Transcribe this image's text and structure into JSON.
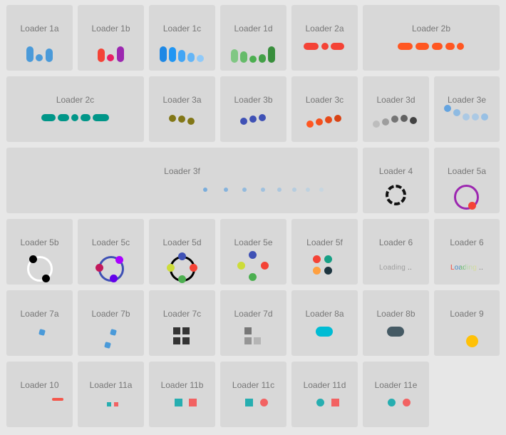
{
  "loaders": [
    {
      "id": "1a",
      "label": "Loader 1a"
    },
    {
      "id": "1b",
      "label": "Loader 1b"
    },
    {
      "id": "1c",
      "label": "Loader 1c"
    },
    {
      "id": "1d",
      "label": "Loader 1d"
    },
    {
      "id": "2a",
      "label": "Loader 2a"
    },
    {
      "id": "2b",
      "label": "Loader 2b"
    },
    {
      "id": "2c",
      "label": "Loader 2c"
    },
    {
      "id": "3a",
      "label": "Loader 3a"
    },
    {
      "id": "3b",
      "label": "Loader 3b"
    },
    {
      "id": "3c",
      "label": "Loader 3c"
    },
    {
      "id": "3d",
      "label": "Loader 3d"
    },
    {
      "id": "3e",
      "label": "Loader 3e"
    },
    {
      "id": "3f",
      "label": "Loader 3f"
    },
    {
      "id": "4",
      "label": "Loader 4"
    },
    {
      "id": "5a",
      "label": "Loader 5a"
    },
    {
      "id": "5b",
      "label": "Loader 5b"
    },
    {
      "id": "5c",
      "label": "Loader 5c"
    },
    {
      "id": "5d",
      "label": "Loader 5d"
    },
    {
      "id": "5e",
      "label": "Loader 5e"
    },
    {
      "id": "5f",
      "label": "Loader 5f"
    },
    {
      "id": "6a",
      "label": "Loader 6",
      "text": "Loading",
      "ellipsis": ".."
    },
    {
      "id": "6b",
      "label": "Loader 6",
      "text": "Loading",
      "ellipsis": ".."
    },
    {
      "id": "7a",
      "label": "Loader 7a"
    },
    {
      "id": "7b",
      "label": "Loader 7b"
    },
    {
      "id": "7c",
      "label": "Loader 7c"
    },
    {
      "id": "7d",
      "label": "Loader 7d"
    },
    {
      "id": "8a",
      "label": "Loader 8a"
    },
    {
      "id": "8b",
      "label": "Loader 8b"
    },
    {
      "id": "9",
      "label": "Loader 9"
    },
    {
      "id": "10",
      "label": "Loader 10"
    },
    {
      "id": "11a",
      "label": "Loader 11a"
    },
    {
      "id": "11b",
      "label": "Loader 11b"
    },
    {
      "id": "11c",
      "label": "Loader 11c"
    },
    {
      "id": "11d",
      "label": "Loader 11d"
    },
    {
      "id": "11e",
      "label": "Loader 11e"
    }
  ],
  "colors": {
    "1a": "#4a9ad9",
    "1b": [
      "#f44336",
      "#e91e63",
      "#9c27b0"
    ],
    "1c": [
      "#1e88e5",
      "#2196f3",
      "#42a5f5",
      "#64b5f6",
      "#90caf9"
    ],
    "1d": [
      "#81c784",
      "#66bb6a",
      "#4caf50",
      "#43a047",
      "#388e3c"
    ],
    "2a": "#f44336",
    "2b": "#ff5722",
    "2c": "#009688",
    "3a": "#827717",
    "3b": "#3f51b5",
    "3c": [
      "#ff5722",
      "#f4511e",
      "#e64a19",
      "#d84315"
    ],
    "3d": [
      "#bdbdbd",
      "#9e9e9e",
      "#757575",
      "#616161",
      "#424242"
    ],
    "3f": "#5b9bd5",
    "5a": {
      "ring": "#9c27b0",
      "dot": "#f44336"
    },
    "5c": {
      "ring": "#3f51b5",
      "dots": [
        "#c2185b",
        "#aa00ff",
        "#6200ea"
      ]
    },
    "5d": [
      "#3f51b5",
      "#f44336",
      "#4caf50",
      "#cddc39"
    ],
    "5f": [
      "#f44336",
      "#16a085",
      "#ffa040",
      "#1d3540"
    ],
    "6b": [
      "#f44336",
      "#3f88c5",
      "#66bb6a",
      "#a5d6a7",
      "#dcdc9a"
    ],
    "8a": "#00bcd4",
    "8b": "#455a64",
    "9": "#ffc107",
    "10": "#f4564b",
    "11teal": "#26aeb0",
    "11red": "#f26262"
  }
}
